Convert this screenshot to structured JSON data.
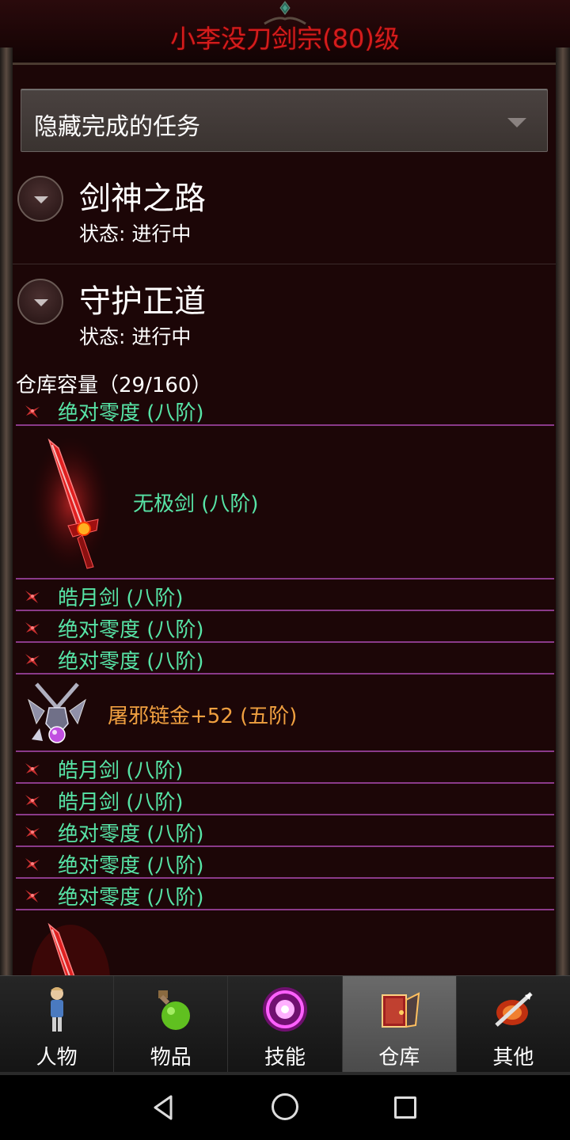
{
  "header": {
    "title": "小李没刀剑宗(80)级"
  },
  "filter": {
    "label": "隐藏完成的任务"
  },
  "quests": [
    {
      "title": "剑神之路",
      "status": "状态: 进行中"
    },
    {
      "title": "守护正道",
      "status": "状态: 进行中"
    }
  ],
  "storage": {
    "capacity": "仓库容量（29/160）",
    "items": [
      {
        "kind": "small",
        "name": "绝对零度 (八阶)"
      },
      {
        "kind": "big",
        "name": "无极剑 (八阶)",
        "icon": "red-sword-icon"
      },
      {
        "kind": "small",
        "name": "皓月剑 (八阶)"
      },
      {
        "kind": "small",
        "name": "绝对零度 (八阶)"
      },
      {
        "kind": "small",
        "name": "绝对零度 (八阶)"
      },
      {
        "kind": "mid",
        "name": "屠邪链金+52 (五阶)",
        "icon": "amulet-icon"
      },
      {
        "kind": "small",
        "name": "皓月剑 (八阶)"
      },
      {
        "kind": "small",
        "name": "皓月剑 (八阶)"
      },
      {
        "kind": "small",
        "name": "绝对零度 (八阶)"
      },
      {
        "kind": "small",
        "name": "绝对零度 (八阶)"
      },
      {
        "kind": "small",
        "name": "绝对零度 (八阶)"
      }
    ]
  },
  "tabs": [
    {
      "label": "人物",
      "icon": "character-icon"
    },
    {
      "label": "物品",
      "icon": "potion-icon"
    },
    {
      "label": "技能",
      "icon": "skill-orb-icon"
    },
    {
      "label": "仓库",
      "icon": "warehouse-icon",
      "active": true
    },
    {
      "label": "其他",
      "icon": "sword-shield-icon"
    }
  ],
  "colors": {
    "title_red": "#d41c1c",
    "item_green": "#57e4a6",
    "item_orange": "#f0a040",
    "divider_purple": "#8a3a8a",
    "panel_bg": "#1c0607"
  }
}
